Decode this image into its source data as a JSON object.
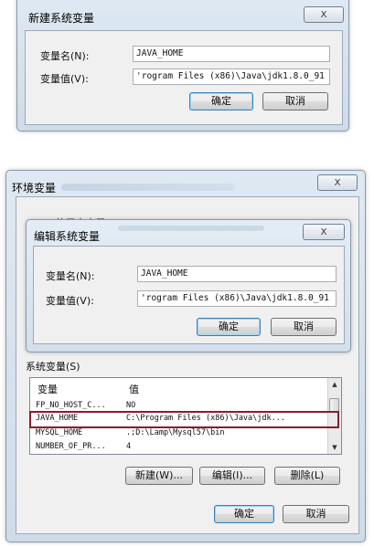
{
  "dialog_new": {
    "title": "新建系统变量",
    "close_glyph": "X",
    "name_label": "变量名(N):",
    "name_value": "JAVA_HOME",
    "value_label": "变量值(V):",
    "value_value": "'rogram Files (x86)\\Java\\jdk1.8.0_91",
    "ok_label": "确定",
    "cancel_label": "取消"
  },
  "env_window": {
    "title": "环境变量",
    "close_glyph": "X",
    "user_vars_partial": "1 的用户变量(U)",
    "system_vars_label": "系统变量(S)",
    "table": {
      "columns": [
        "变量",
        "值"
      ],
      "rows": [
        {
          "name": "FP_NO_HOST_C...",
          "value": "NO"
        },
        {
          "name": "JAVA_HOME",
          "value": "C:\\Program Files (x86)\\Java\\jdk..."
        },
        {
          "name": "MYSQL_HOME",
          "value": ".;D:\\Lamp\\Mysql57\\bin"
        },
        {
          "name": "NUMBER_OF_PR...",
          "value": "4"
        }
      ]
    },
    "new_label": "新建(W)...",
    "edit_label": "编辑(I)...",
    "delete_label": "删除(L)",
    "ok_label": "确定",
    "cancel_label": "取消"
  },
  "dialog_edit": {
    "title": "编辑系统变量",
    "close_glyph": "X",
    "name_label": "变量名(N):",
    "name_value": "JAVA_HOME",
    "value_label": "变量值(V):",
    "value_value": "'rogram Files (x86)\\Java\\jdk1.8.0_91",
    "ok_label": "确定",
    "cancel_label": "取消"
  },
  "icons": {
    "close": "close-icon",
    "scroll_up": "scroll-up-icon",
    "scroll_down": "scroll-down-icon"
  },
  "colors": {
    "highlight": "#8a1c2c",
    "frame": "#cfdbe8"
  }
}
